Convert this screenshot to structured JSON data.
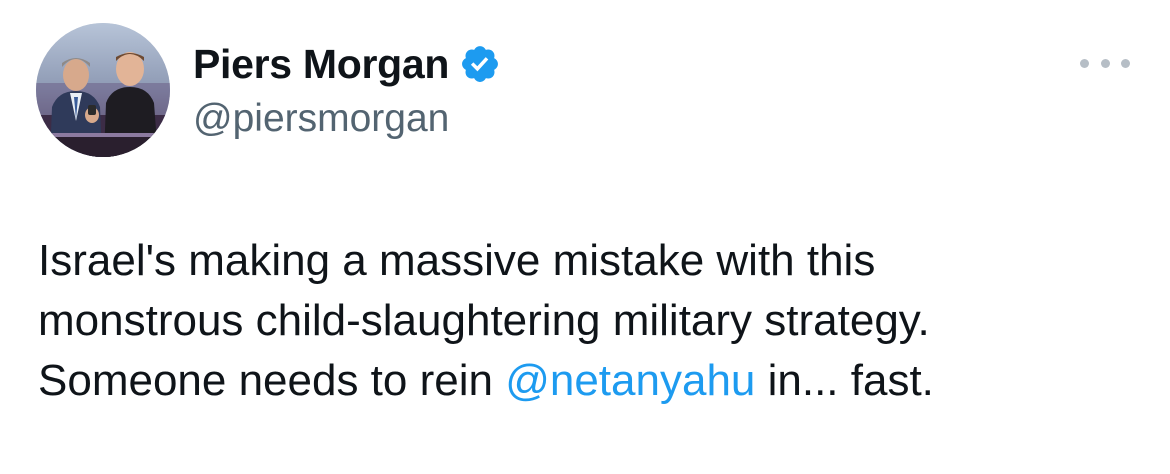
{
  "author": {
    "display_name": "Piers Morgan",
    "handle": "@piersmorgan",
    "verified": true,
    "verified_icon": "verified-badge-icon",
    "avatar_icon": "profile-photo"
  },
  "tweet": {
    "line1": "Israel's making a massive mistake with this",
    "line2": "monstrous child-slaughtering military strategy.",
    "line3_prefix": "Someone needs to rein ",
    "line3_mention": "@netanyahu",
    "line3_suffix": " in... fast."
  },
  "more_icon": "more-options-icon",
  "colors": {
    "text": "#0f1419",
    "secondary_text": "#536471",
    "link": "#1d9bf0",
    "verified": "#1d9bf0",
    "more_dots": "#b6bec6"
  }
}
